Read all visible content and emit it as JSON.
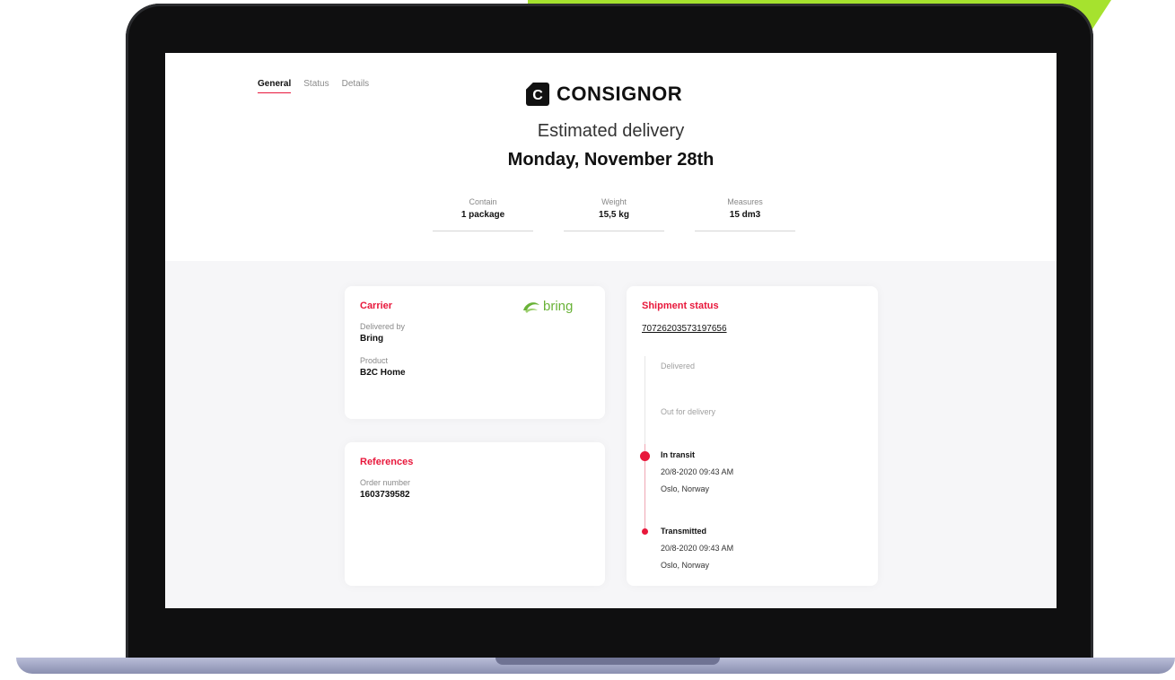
{
  "colors": {
    "accent": "#e8173b",
    "accent_shape": "#a6e22e",
    "bring_green": "#69b237"
  },
  "tabs": [
    {
      "label": "General",
      "active": true
    },
    {
      "label": "Status",
      "active": false
    },
    {
      "label": "Details",
      "active": false
    }
  ],
  "brand": {
    "name": "CONSIGNOR",
    "mark": "C"
  },
  "estimated": {
    "label": "Estimated delivery",
    "date": "Monday, November 28th"
  },
  "summary": [
    {
      "label": "Contain",
      "value": "1 package"
    },
    {
      "label": "Weight",
      "value": "15,5 kg"
    },
    {
      "label": "Measures",
      "value": "15 dm3"
    }
  ],
  "carrier": {
    "title": "Carrier",
    "logo_text": "bring",
    "delivered_by_label": "Delivered by",
    "delivered_by_value": "Bring",
    "product_label": "Product",
    "product_value": "B2C Home"
  },
  "references": {
    "title": "References",
    "order_label": "Order number",
    "order_value": "1603739582"
  },
  "shipment": {
    "title": "Shipment status",
    "tracking_number": "70726203573197656",
    "steps": [
      {
        "title": "Delivered",
        "state": "pending"
      },
      {
        "title": "Out for delivery",
        "state": "pending"
      },
      {
        "title": "In transit",
        "date": "20/8-2020  09:43 AM",
        "location": "Oslo, Norway",
        "state": "current"
      },
      {
        "title": "Transmitted",
        "date": "20/8-2020  09:43 AM",
        "location": "Oslo, Norway",
        "state": "done"
      }
    ]
  }
}
